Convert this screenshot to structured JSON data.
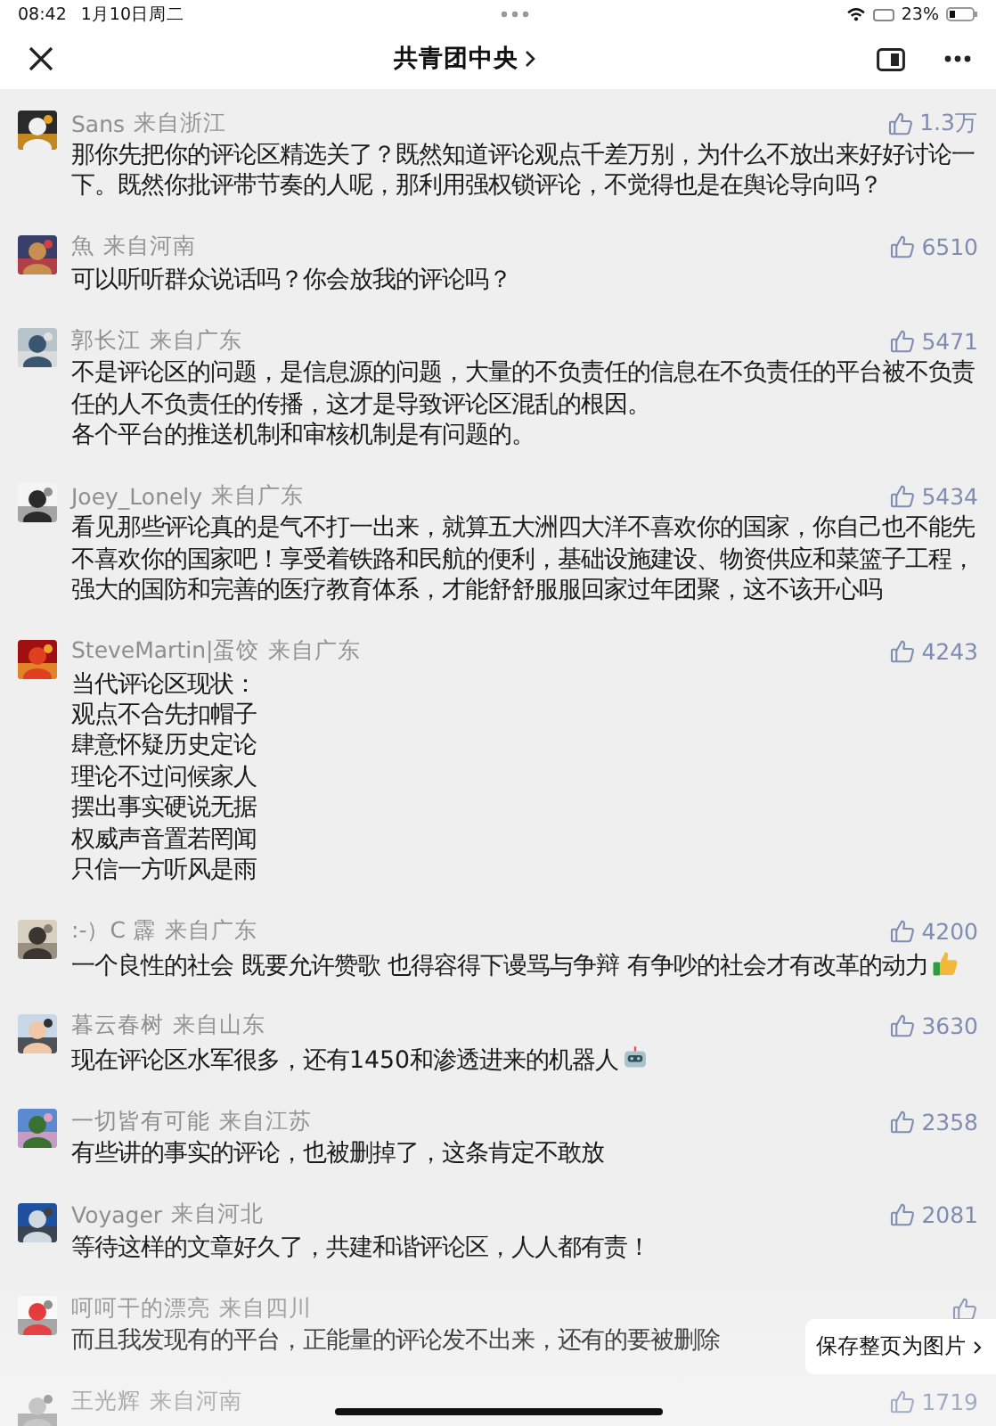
{
  "status_bar": {
    "time": "08:42",
    "date": "1月10日周二",
    "battery": "23%"
  },
  "nav": {
    "title": "共青团中央"
  },
  "comments": [
    {
      "name": "Sans",
      "location": "来自浙江",
      "likes": "1.3万",
      "text": "那你先把你的评论区精选关了？既然知道评论观点千差万别，为什么不放出来好好讨论一下。既然你批评带节奏的人呢，那利用强权锁评论，不觉得也是在舆论导向吗？"
    },
    {
      "name": "魚",
      "location": "来自河南",
      "likes": "6510",
      "text": "可以听听群众说话吗？你会放我的评论吗？"
    },
    {
      "name": "郭长江",
      "location": "来自广东",
      "likes": "5471",
      "text": [
        "不是评论区的问题，是信息源的问题，大量的不负责任的信息在不负责任的平台被不负责任的人不负责任的传播，这才是导致评论区混乱的根因。",
        "各个平台的推送机制和审核机制是有问题的。"
      ]
    },
    {
      "name": "Joey_Lonely",
      "location": "来自广东",
      "likes": "5434",
      "text": "看见那些评论真的是气不打一出来，就算五大洲四大洋不喜欢你的国家，你自己也不能先不喜欢你的国家吧！享受着铁路和民航的便利，基础设施建设、物资供应和菜篮子工程，强大的国防和完善的医疗教育体系，才能舒舒服服回家过年团聚，这不该开心吗"
    },
    {
      "name": "SteveMartin|蛋饺",
      "location": "来自广东",
      "likes": "4243",
      "text": [
        "当代评论区现状：",
        "观点不合先扣帽子",
        "肆意怀疑历史定论",
        "理论不过问候家人",
        "摆出事实硬说无据",
        "权威声音置若罔闻",
        "只信一方听风是雨"
      ]
    },
    {
      "name": ":-）C 霹",
      "location": "来自广东",
      "likes": "4200",
      "text": "一个良性的社会 既要允许赞歌 也得容得下谩骂与争辩 有争吵的社会才有改革的动力"
    },
    {
      "name": "暮云春树",
      "location": "来自山东",
      "likes": "3630",
      "text": "现在评论区水军很多，还有1450和渗透进来的机器人"
    },
    {
      "name": "一切皆有可能",
      "location": "来自江苏",
      "likes": "2358",
      "text": "有些讲的事实的评论，也被删掉了，这条肯定不敢放"
    },
    {
      "name": "Voyager",
      "location": "来自河北",
      "likes": "2081",
      "text": "等待这样的文章好久了，共建和谐评论区，人人都有责！"
    },
    {
      "name": "呵呵干的漂亮",
      "location": "来自四川",
      "text": "而且我发现有的平台，正能量的评论发不出来，还有的要被删除"
    },
    {
      "name": "王光辉",
      "location": "来自河南",
      "likes": "1719"
    }
  ],
  "save_button": {
    "label": "保存整页为图片"
  }
}
